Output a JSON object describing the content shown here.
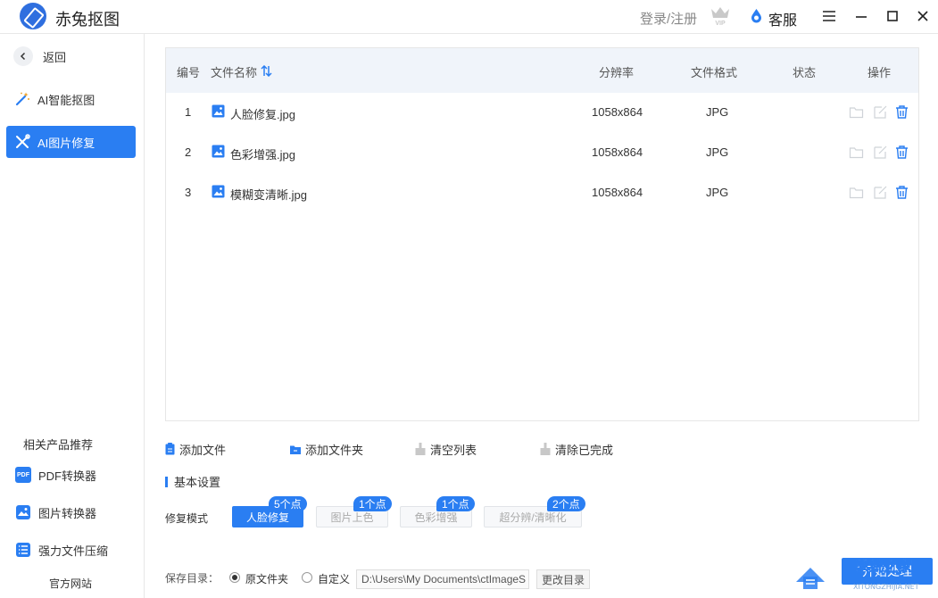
{
  "titlebar": {
    "app_title": "赤兔抠图",
    "login": "登录/注册",
    "vip_icon": "vip-crown-icon",
    "service": "客服"
  },
  "sidebar": {
    "back": "返回",
    "items": [
      {
        "label": "AI智能抠图",
        "icon": "magic-wand-icon",
        "active": false
      },
      {
        "label": "AI图片修复",
        "icon": "tools-icon",
        "active": true
      }
    ],
    "recommend_title": "相关产品推荐",
    "recommend": [
      {
        "label": "PDF转换器",
        "icon_text": "PDF"
      },
      {
        "label": "图片转换器",
        "icon_text": ""
      },
      {
        "label": "强力文件压缩",
        "icon_text": ""
      }
    ],
    "official_site": "官方网站"
  },
  "table": {
    "headers": {
      "index": "编号",
      "name": "文件名称",
      "resolution": "分辨率",
      "format": "文件格式",
      "status": "状态",
      "actions": "操作"
    },
    "rows": [
      {
        "index": "1",
        "name": "人脸修复.jpg",
        "resolution": "1058x864",
        "format": "JPG",
        "status": ""
      },
      {
        "index": "2",
        "name": "色彩增强.jpg",
        "resolution": "1058x864",
        "format": "JPG",
        "status": ""
      },
      {
        "index": "3",
        "name": "模糊变清晰.jpg",
        "resolution": "1058x864",
        "format": "JPG",
        "status": ""
      }
    ]
  },
  "toolbar": {
    "add_file": "添加文件",
    "add_folder": "添加文件夹",
    "clear_list": "清空列表",
    "clear_done": "清除已完成"
  },
  "settings": {
    "title": "基本设置",
    "mode_label": "修复模式",
    "modes": [
      {
        "label": "人脸修复",
        "badge": "5个点",
        "active": true
      },
      {
        "label": "图片上色",
        "badge": "1个点",
        "active": false
      },
      {
        "label": "色彩增强",
        "badge": "1个点",
        "active": false
      },
      {
        "label": "超分辨/清晰化",
        "badge": "2个点",
        "active": false
      }
    ]
  },
  "save": {
    "label": "保存目录：",
    "option_original": "原文件夹",
    "option_custom": "自定义",
    "selected": "原文件夹",
    "path": "D:\\Users\\My Documents\\ctImageS",
    "change_button": "更改目录",
    "start_button": "开始处理"
  },
  "watermark": {
    "text": "系统之家",
    "subtext": "XITONGZHIJIA.NET"
  },
  "colors": {
    "accent": "#2a7ef2",
    "header_bg": "#f0f4fa",
    "sidebar_border": "#e6e6e6",
    "disabled_icon": "#c8c8c8"
  }
}
